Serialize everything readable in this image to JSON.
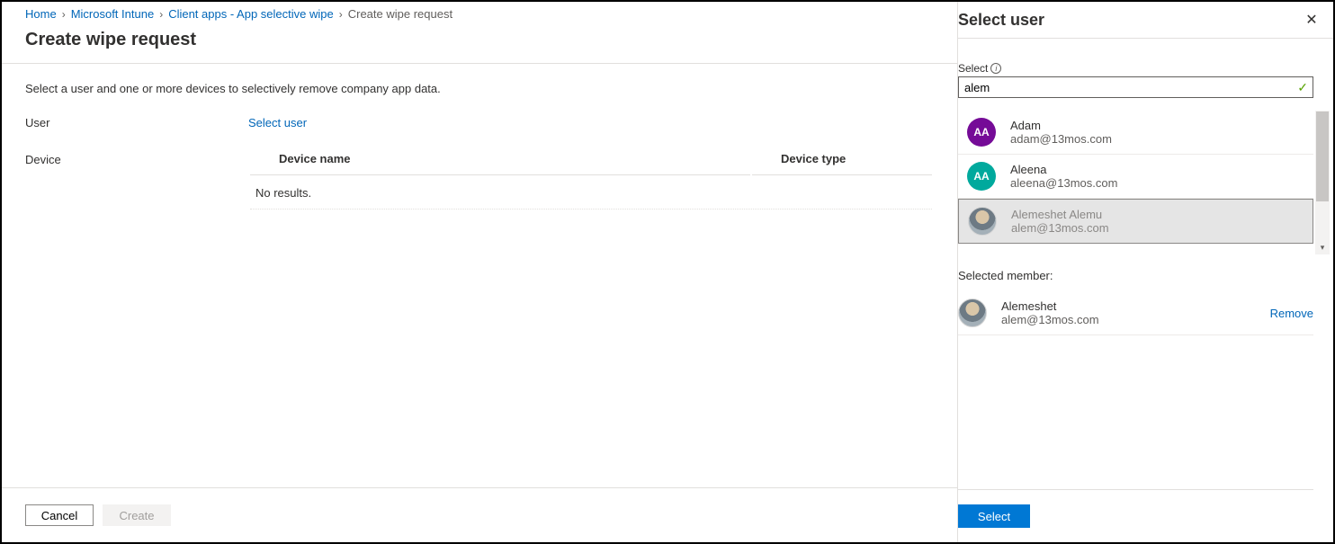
{
  "breadcrumb": {
    "items": [
      "Home",
      "Microsoft Intune",
      "Client apps - App selective wipe"
    ],
    "current": "Create wipe request"
  },
  "page": {
    "title": "Create wipe request",
    "intro": "Select a user and one or more devices to selectively remove company app data."
  },
  "form": {
    "user_label": "User",
    "select_user_link": "Select user",
    "device_label": "Device",
    "device_name_col": "Device name",
    "device_type_col": "Device type",
    "no_results": "No results."
  },
  "footer": {
    "cancel": "Cancel",
    "create": "Create"
  },
  "panel": {
    "title": "Select user",
    "search_label": "Select",
    "search_value": "alem",
    "results": [
      {
        "initials": "AA",
        "avatar_class": "purple",
        "name": "Adam",
        "email": "adam@13mos.com"
      },
      {
        "initials": "AA",
        "avatar_class": "teal",
        "name": "Aleena",
        "email": "aleena@13mos.com"
      },
      {
        "initials": "",
        "avatar_class": "photo",
        "name": "Alemeshet Alemu",
        "email": "alem@13mos.com",
        "selected": true
      }
    ],
    "selected_heading": "Selected member:",
    "selected": {
      "name": "Alemeshet",
      "email": "alem@13mos.com"
    },
    "remove": "Remove",
    "select_btn": "Select"
  }
}
